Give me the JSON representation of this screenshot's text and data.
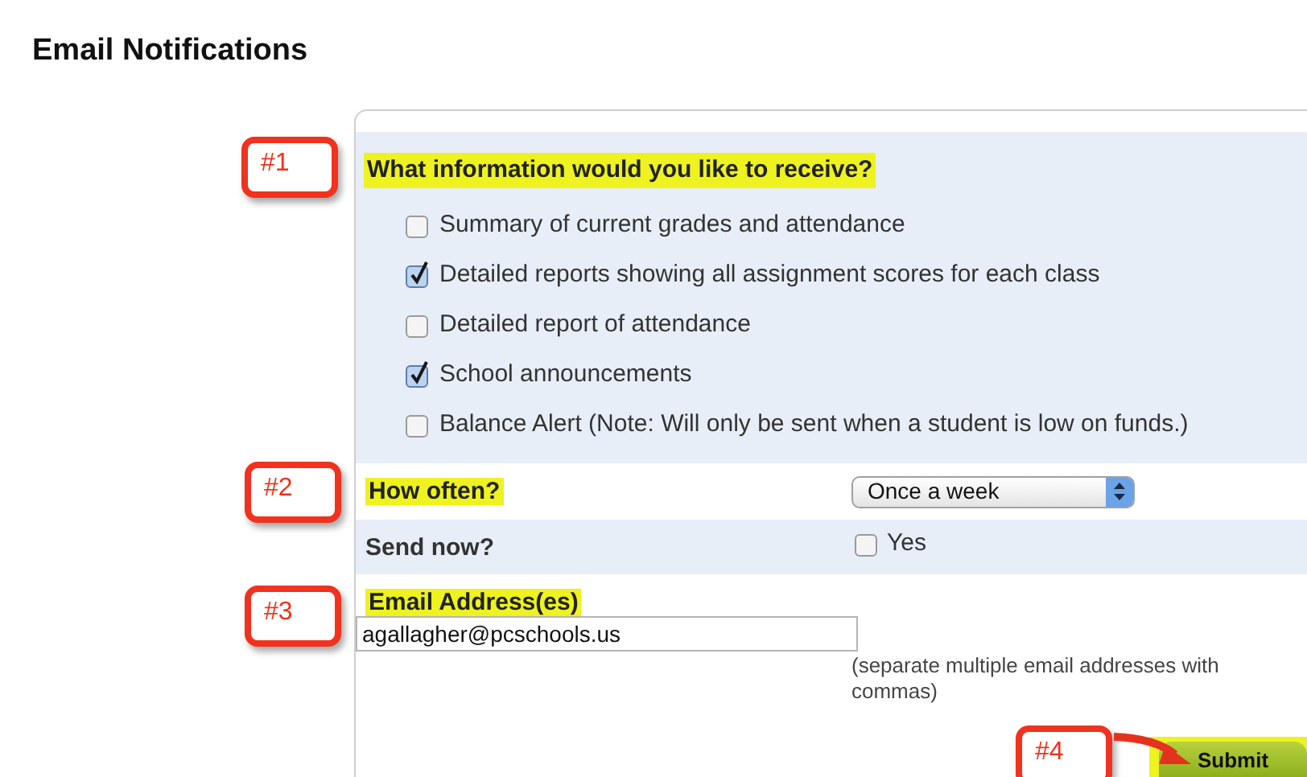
{
  "page_title": "Email Notifications",
  "info": {
    "question": "What information would you like to receive?",
    "options": [
      {
        "label": "Summary of current grades and attendance",
        "checked": false
      },
      {
        "label": "Detailed reports showing all assignment scores for each class",
        "checked": true
      },
      {
        "label": "Detailed report of attendance",
        "checked": false
      },
      {
        "label": "School announcements",
        "checked": true
      },
      {
        "label": "Balance Alert (Note: Will only be sent when a student is low on funds.)",
        "checked": false
      }
    ]
  },
  "how_often": {
    "label": "How often?",
    "value": "Once a week"
  },
  "send_now": {
    "label": "Send now?",
    "option": "Yes",
    "checked": false
  },
  "email": {
    "label": "Email Address(es)",
    "value": "agallagher@pcschools.us",
    "hint": "(separate multiple email addresses with commas)"
  },
  "submit": "Submit",
  "callouts": [
    "#1",
    "#2",
    "#3",
    "#4"
  ]
}
